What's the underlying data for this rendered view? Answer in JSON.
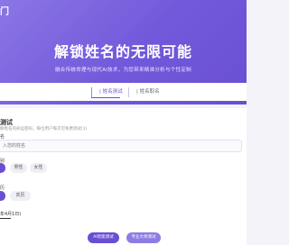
{
  "header": {
    "brand": "门",
    "title": "解锁姓名的无限可能",
    "subtitle": "融合传统命理与现代AI技术，为您带来精准分析与个性定制"
  },
  "tabs": [
    {
      "label": "| 姓名测试"
    },
    {
      "label": "| 姓名取名"
    }
  ],
  "form": {
    "title": "测试",
    "description": "解姓名的命运密码，每位用户每次可免费测试(1)",
    "name_label": "名",
    "name_placeholder": "入您的姓名",
    "gender_label": "别",
    "gender_options": [
      "",
      "男性",
      "女性"
    ],
    "calendar_label": "历",
    "calendar_options": [
      "",
      "农历"
    ],
    "dob_label": "",
    "date_value": "年4月1日)"
  },
  "actions": {
    "primary": "AI智能测试",
    "secondary": "专业大师测试"
  },
  "colors": {
    "accent": "#6a4fd3",
    "hero_start": "#8b76e6",
    "hero_end": "#6a4fd3"
  }
}
